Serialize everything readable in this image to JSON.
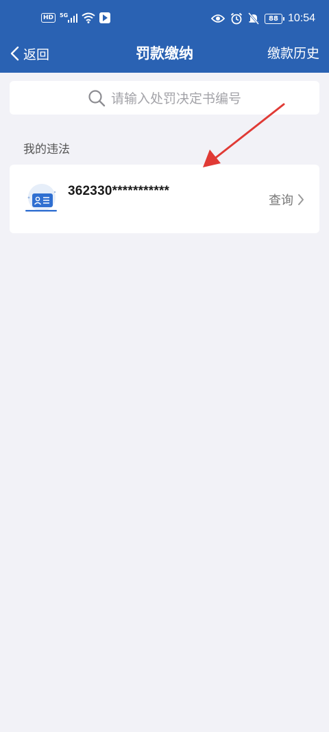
{
  "status_bar": {
    "network_badge": "HD",
    "signal_label": "5G",
    "battery": "88",
    "time": "10:54"
  },
  "nav": {
    "back_label": "返回",
    "title": "罚款缴纳",
    "history_label": "缴款历史"
  },
  "search": {
    "placeholder": "请输入处罚决定书编号"
  },
  "section": {
    "title": "我的违法"
  },
  "violations": [
    {
      "id_number": "362330***********",
      "action_label": "查询"
    }
  ],
  "colors": {
    "brand": "#2a62b3",
    "background": "#f2f2f7",
    "annotation_arrow": "#e03a35"
  }
}
